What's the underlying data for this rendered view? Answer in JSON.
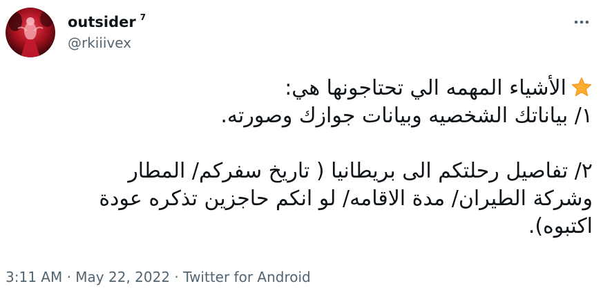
{
  "user": {
    "display_name": "outsider",
    "name_superscript": "7",
    "handle": "@rkiiivex"
  },
  "header": {
    "more_icon": "more-horizontal-icon"
  },
  "tweet": {
    "paragraphs": [
      {
        "lines": [
          {
            "icon": "star-emoji",
            "text": "الأشياء المهمه الي تحتاجونها هي:"
          },
          {
            "text": "١/ بياناتك الشخصيه وبيانات جوازك وصورته."
          }
        ]
      },
      {
        "lines": [
          {
            "text": "٢/ تفاصيل رحلتكم الى بريطانيا ( تاريخ سفركم/ المطار"
          },
          {
            "text": "وشركة الطيران/ مدة الاقامه/ لو انكم حاجزين تذكره عودة"
          },
          {
            "text": "اكتبوه)."
          }
        ]
      }
    ]
  },
  "meta": {
    "time": "3:11 AM",
    "separator": " · ",
    "date": "May 22, 2022",
    "source": "Twitter for Android"
  },
  "colors": {
    "text_primary": "#0f1419",
    "text_secondary": "#536471",
    "star": "#ffac33"
  }
}
